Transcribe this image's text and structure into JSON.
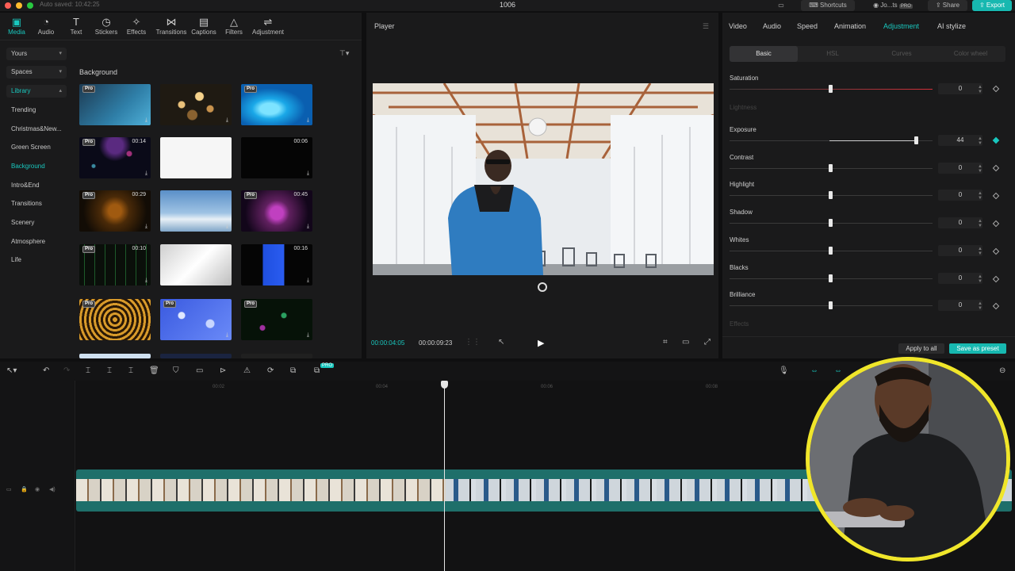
{
  "titlebar": {
    "autosave": "Auto saved: 10:42:25",
    "project_title": "1006",
    "shortcuts_label": "Shortcuts",
    "user_label": "Jo...ts",
    "user_badge": "PRO",
    "share_label": "Share",
    "export_label": "Export"
  },
  "media_tabs": [
    {
      "label": "Media",
      "icon": "media-icon"
    },
    {
      "label": "Audio",
      "icon": "audio-icon"
    },
    {
      "label": "Text",
      "icon": "text-icon"
    },
    {
      "label": "Stickers",
      "icon": "stickers-icon"
    },
    {
      "label": "Effects",
      "icon": "effects-icon"
    },
    {
      "label": "Transitions",
      "icon": "transitions-icon"
    },
    {
      "label": "Captions",
      "icon": "captions-icon"
    },
    {
      "label": "Filters",
      "icon": "filters-icon"
    },
    {
      "label": "Adjustment",
      "icon": "adjustment-icon"
    }
  ],
  "sidebar": {
    "yours": "Yours",
    "spaces": "Spaces",
    "library": "Library",
    "categories": [
      "Trending",
      "Christmas&New...",
      "Green Screen",
      "Background",
      "Intro&End",
      "Transitions",
      "Scenery",
      "Atmosphere",
      "Life"
    ],
    "active_category": "Background"
  },
  "library": {
    "heading": "Background",
    "pro_badge": "Pro",
    "durations": [
      "00:14",
      "00:06",
      "00:29",
      "00:45",
      "00:10",
      "00:16"
    ]
  },
  "player": {
    "title": "Player",
    "current_time": "00:00:04:05",
    "total_time": "00:00:09:23"
  },
  "inspector": {
    "tabs": [
      "Video",
      "Audio",
      "Speed",
      "Animation",
      "Adjustment",
      "AI stylize"
    ],
    "active_tab": "Adjustment",
    "subtabs": [
      "Basic",
      "HSL",
      "Curves",
      "Color wheel"
    ],
    "active_subtab": "Basic",
    "saturation": {
      "label": "Saturation",
      "value": "0"
    },
    "lightness": {
      "label": "Lightness"
    },
    "exposure": {
      "label": "Exposure",
      "value": "44"
    },
    "contrast": {
      "label": "Contrast",
      "value": "0"
    },
    "highlight": {
      "label": "Highlight",
      "value": "0"
    },
    "shadow": {
      "label": "Shadow",
      "value": "0"
    },
    "whites": {
      "label": "Whites",
      "value": "0"
    },
    "blacks": {
      "label": "Blacks",
      "value": "0"
    },
    "brilliance": {
      "label": "Brilliance",
      "value": "0"
    },
    "effects": {
      "label": "Effects"
    },
    "apply_all": "Apply to all",
    "save_preset": "Save as preset"
  },
  "timeline": {
    "ruler": [
      "00:02",
      "00:04",
      "00:06",
      "00:08"
    ],
    "tool_badge": "PRO"
  },
  "colors": {
    "accent": "#19c7be",
    "clip": "#1e6f6a",
    "webcam_ring": "#f0e62a",
    "saturation_track": "#d6303a"
  }
}
